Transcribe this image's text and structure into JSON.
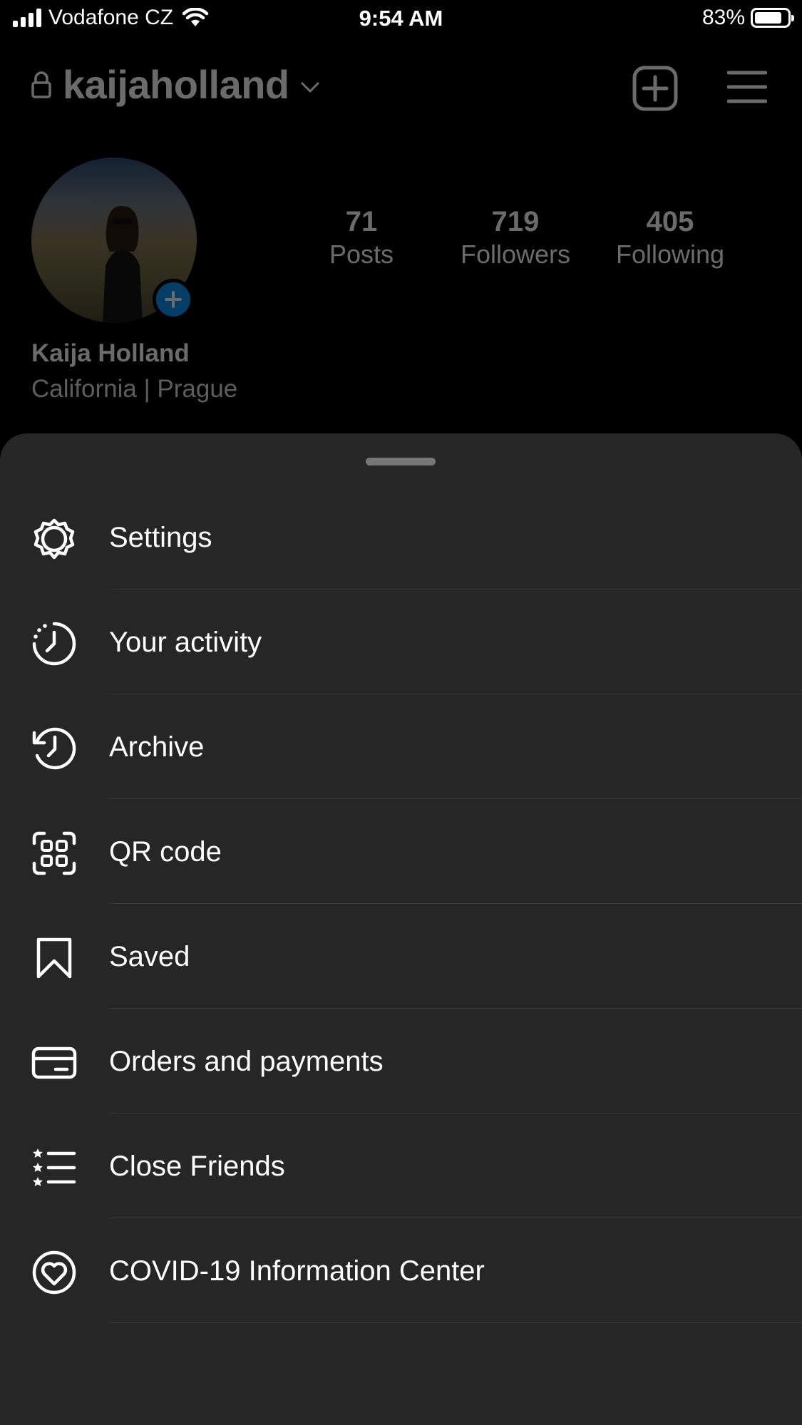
{
  "status_bar": {
    "carrier": "Vodafone CZ",
    "time": "9:54 AM",
    "battery_percent_label": "83%",
    "battery_level": 0.83
  },
  "profile": {
    "username": "kaijaholland",
    "full_name": "Kaija Holland",
    "bio": "California | Prague",
    "stats": [
      {
        "value": "71",
        "label": "Posts"
      },
      {
        "value": "719",
        "label": "Followers"
      },
      {
        "value": "405",
        "label": "Following"
      }
    ]
  },
  "menu": {
    "items": [
      {
        "label": "Settings",
        "icon": "gear-icon"
      },
      {
        "label": "Your activity",
        "icon": "activity-icon"
      },
      {
        "label": "Archive",
        "icon": "archive-icon"
      },
      {
        "label": "QR code",
        "icon": "qr-code-icon"
      },
      {
        "label": "Saved",
        "icon": "bookmark-icon"
      },
      {
        "label": "Orders and payments",
        "icon": "card-icon"
      },
      {
        "label": "Close Friends",
        "icon": "close-friends-icon"
      },
      {
        "label": "COVID-19 Information Center",
        "icon": "heart-circle-icon"
      }
    ]
  }
}
